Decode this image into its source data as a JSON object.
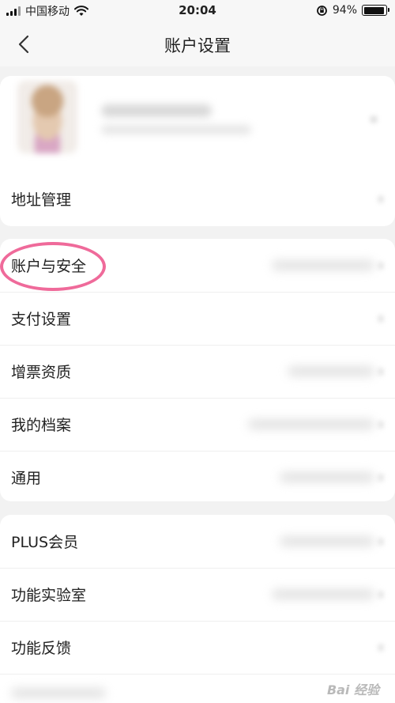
{
  "status_bar": {
    "carrier": "中国移动",
    "time": "20:04",
    "battery_percent": "94%",
    "battery_level": 0.94,
    "icons": [
      "signal-icon",
      "wifi-icon",
      "rotation-lock-icon",
      "battery-icon"
    ]
  },
  "nav": {
    "title": "账户设置",
    "back_icon": "chevron-left-icon"
  },
  "profile": {
    "address_label": "地址管理"
  },
  "account_group": [
    {
      "label": "账户与安全",
      "highlighted": true
    },
    {
      "label": "支付设置"
    },
    {
      "label": "增票资质"
    },
    {
      "label": "我的档案"
    },
    {
      "label": "通用"
    }
  ],
  "plus_group": [
    {
      "label": "PLUS会员"
    },
    {
      "label": "功能实验室"
    },
    {
      "label": "功能反馈"
    }
  ],
  "colors": {
    "background": "#f2f2f2",
    "card": "#ffffff",
    "highlight": "#ef6a9a",
    "text": "#222222"
  },
  "watermark": "Bai 经验"
}
